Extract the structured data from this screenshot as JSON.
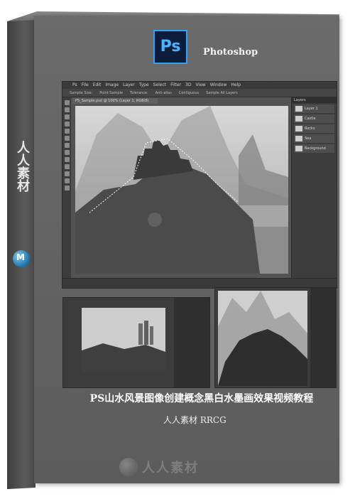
{
  "cover": {
    "app_name": "Photoshop",
    "logo_text": "Ps",
    "spine_text": "人人素材",
    "title": "PS山水风景图像创建概念黑白水墨画效果视频教程",
    "brand": "人人素材 RRCG",
    "watermark": "人人素材"
  },
  "app": {
    "menu": [
      "Ps",
      "File",
      "Edit",
      "Image",
      "Layer",
      "Type",
      "Select",
      "Filter",
      "3D",
      "View",
      "Window",
      "Help"
    ],
    "options": [
      "Sample Size:",
      "Point Sample",
      "Tolerance:",
      "Anti-alias",
      "Contiguous",
      "Sample All Layers"
    ],
    "doc_tab": "PS_Sample.psd @ 100% (Layer 1, RGB/8)",
    "layers_title": "Layers",
    "layers": [
      "Layer 1",
      "Castle",
      "Rocks",
      "Sea",
      "Background"
    ]
  }
}
